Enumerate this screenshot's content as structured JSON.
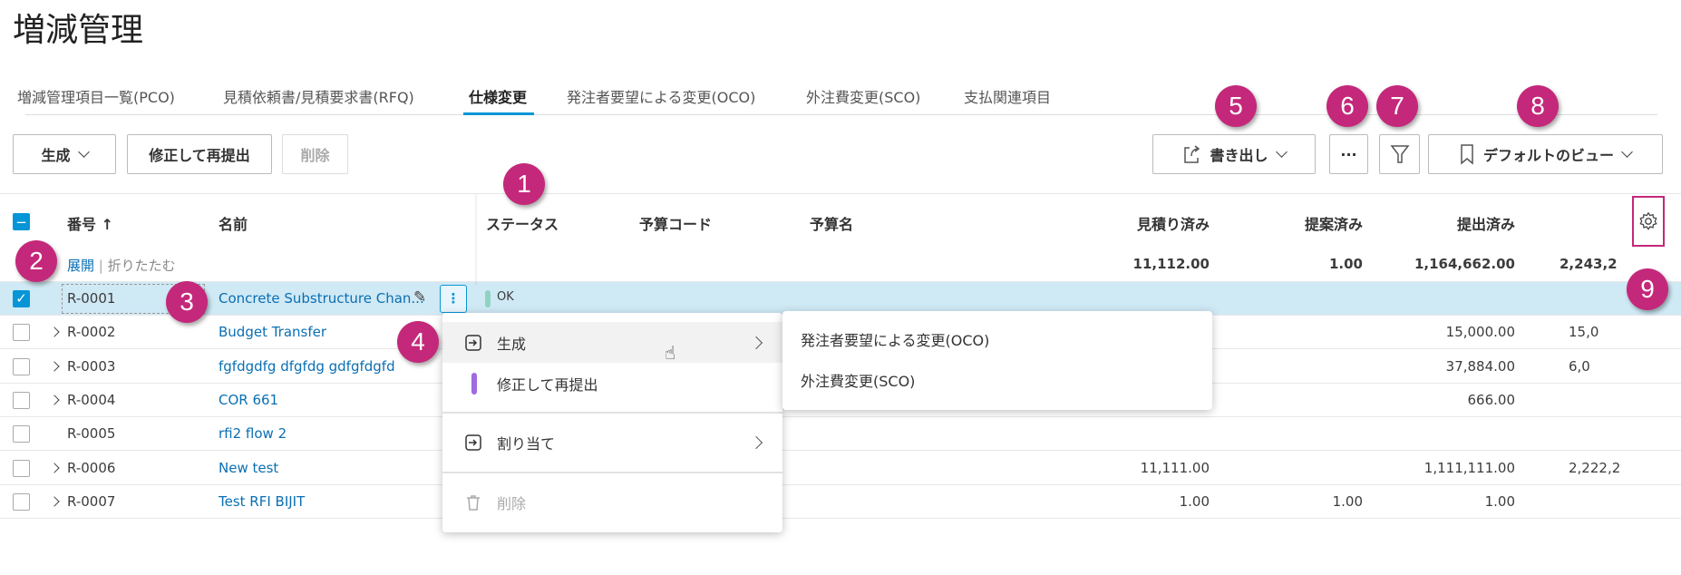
{
  "title": "増減管理",
  "tabs": [
    "増減管理項目一覧(PCO)",
    "見積依頼書/見積要求書(RFQ)",
    "仕様変更",
    "発注者要望による変更(OCO)",
    "外注費変更(SCO)",
    "支払関連項目"
  ],
  "toolbar": {
    "create": "生成",
    "resubmit": "修正して再提出",
    "delete": "削除",
    "export": "書き出し",
    "more": "···",
    "view": "デフォルトのビュー"
  },
  "columns": {
    "number": "番号",
    "name": "名前",
    "status": "ステータス",
    "budget_code": "予算コード",
    "budget_name": "予算名",
    "estimated": "見積り済み",
    "proposed": "提案済み",
    "submitted": "提出済み"
  },
  "expand": "展開",
  "collapse": "折りたたむ",
  "summary": {
    "estimated": "11,112.00",
    "proposed": "1.00",
    "submitted": "1,164,662.00",
    "extra": "2,243,2"
  },
  "rows": [
    {
      "number": "R-0001",
      "name": "Concrete Substructure Chan...",
      "status": "OK",
      "estimated": "",
      "proposed": "",
      "submitted": "",
      "extra": ""
    },
    {
      "number": "R-0002",
      "name": "Budget Transfer",
      "estimated": "",
      "proposed": "",
      "submitted": "15,000.00",
      "extra": "15,0"
    },
    {
      "number": "R-0003",
      "name": "fgfdgdfg dfgfdg gdfgfdgfd",
      "estimated": "",
      "proposed": "",
      "submitted": "37,884.00",
      "extra": "6,0"
    },
    {
      "number": "R-0004",
      "name": "COR 661",
      "estimated": "",
      "proposed": "",
      "submitted": "666.00",
      "extra": ""
    },
    {
      "number": "R-0005",
      "name": "rfi2 flow 2",
      "estimated": "",
      "proposed": "",
      "submitted": "",
      "extra": ""
    },
    {
      "number": "R-0006",
      "name": "New test",
      "estimated": "11,111.00",
      "proposed": "",
      "submitted": "1,111,111.00",
      "extra": "2,222,2"
    },
    {
      "number": "R-0007",
      "name": "Test RFI BIJIT",
      "estimated": "1.00",
      "proposed": "1.00",
      "submitted": "1.00",
      "extra": ""
    }
  ],
  "context_menu": {
    "create": "生成",
    "resubmit": "修正して再提出",
    "assign": "割り当て",
    "delete": "削除"
  },
  "submenu": [
    "発注者要望による変更(OCO)",
    "外注費変更(SCO)"
  ],
  "badges": [
    "1",
    "2",
    "3",
    "4",
    "5",
    "6",
    "7",
    "8",
    "9"
  ],
  "colors": {
    "accent": "#0696d7",
    "badge": "#c4287a",
    "selected_row": "#cfe9f5",
    "status_ok": "#8fd3c4"
  }
}
